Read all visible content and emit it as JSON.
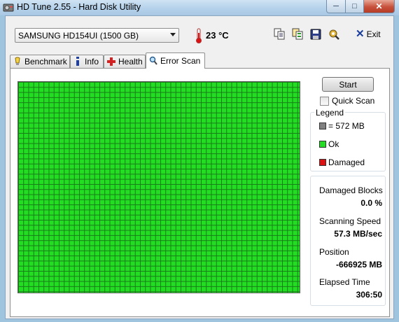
{
  "window": {
    "title": "HD Tune 2.55 - Hard Disk Utility",
    "min_glyph": "─",
    "max_glyph": "□",
    "close_glyph": "✕"
  },
  "toolbar": {
    "drive": "SAMSUNG HD154UI (1500 GB)",
    "temperature": "23 °C",
    "exit_label": "Exit",
    "icons": [
      "copy-info-icon",
      "copy-all-icon",
      "save-icon",
      "options-icon"
    ]
  },
  "tabs": [
    {
      "label": "Benchmark",
      "icon": "benchmark-icon"
    },
    {
      "label": "Info",
      "icon": "info-icon"
    },
    {
      "label": "Health",
      "icon": "health-icon"
    },
    {
      "label": "Error Scan",
      "icon": "error-scan-icon"
    }
  ],
  "active_tab": "Error Scan",
  "scan": {
    "start_label": "Start",
    "quick_scan_label": "Quick Scan",
    "quick_scan_checked": false,
    "block_state": "ok"
  },
  "legend": {
    "title": "Legend",
    "items": [
      {
        "label": "= 572 MB",
        "color": "#808080"
      },
      {
        "label": "Ok",
        "color": "#22dd22"
      },
      {
        "label": "Damaged",
        "color": "#dd1111"
      }
    ]
  },
  "stats": {
    "damaged_blocks_label": "Damaged Blocks",
    "damaged_blocks_value": "0.0 %",
    "speed_label": "Scanning Speed",
    "speed_value": "57.3 MB/sec",
    "position_label": "Position",
    "position_value": "-666925 MB",
    "elapsed_label": "Elapsed Time",
    "elapsed_value": "306:50"
  },
  "colors": {
    "ok_block": "#22dd22",
    "grid_line": "#1a7a1a",
    "title_bar": "#b4d1ea"
  }
}
